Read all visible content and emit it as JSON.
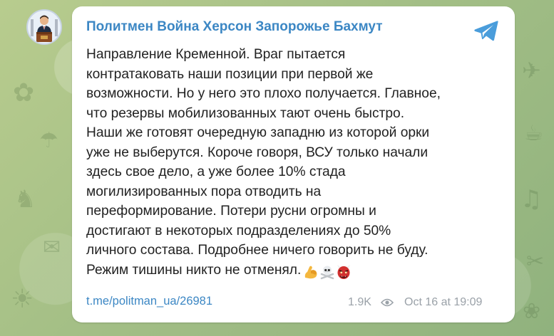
{
  "channel": {
    "name": "Политмен Война Херсон Запорожье Бахмут",
    "avatar_icon": "politician-at-podium-avatar"
  },
  "message": {
    "text_lines": [
      "Направление Кременной. Враг пытается",
      "контратаковать наши позиции при первой же",
      "возможности. Но у него это плохо получается. Главное,",
      "что резервы мобилизованных тают очень быстро.",
      "Наши же готовят очередную западню из которой орки",
      "уже не выберутся. Короче говоря, ВСУ только начали",
      "здесь свое дело, а уже более 10% стада",
      "могилизированных пора отводить на",
      "переформирование. Потери русни огромны и",
      "достигают в некоторых подразделениях до 50%",
      "личного состава. Подробнее ничего говорить не буду.",
      "Режим тишины никто не отменял."
    ],
    "emojis": [
      "flexed-biceps-emoji",
      "skull-and-crossbones-emoji",
      "ogre-mask-emoji"
    ],
    "link": "t.me/politman_ua/26981",
    "views": "1.9K",
    "timestamp": "Oct 16 at 19:09"
  },
  "colors": {
    "accent": "#3c87c4",
    "meta": "#9aa1a8",
    "text": "#222222",
    "bubble": "#ffffff"
  },
  "icons": {
    "share": "telegram-share-icon",
    "views": "eye-icon"
  }
}
